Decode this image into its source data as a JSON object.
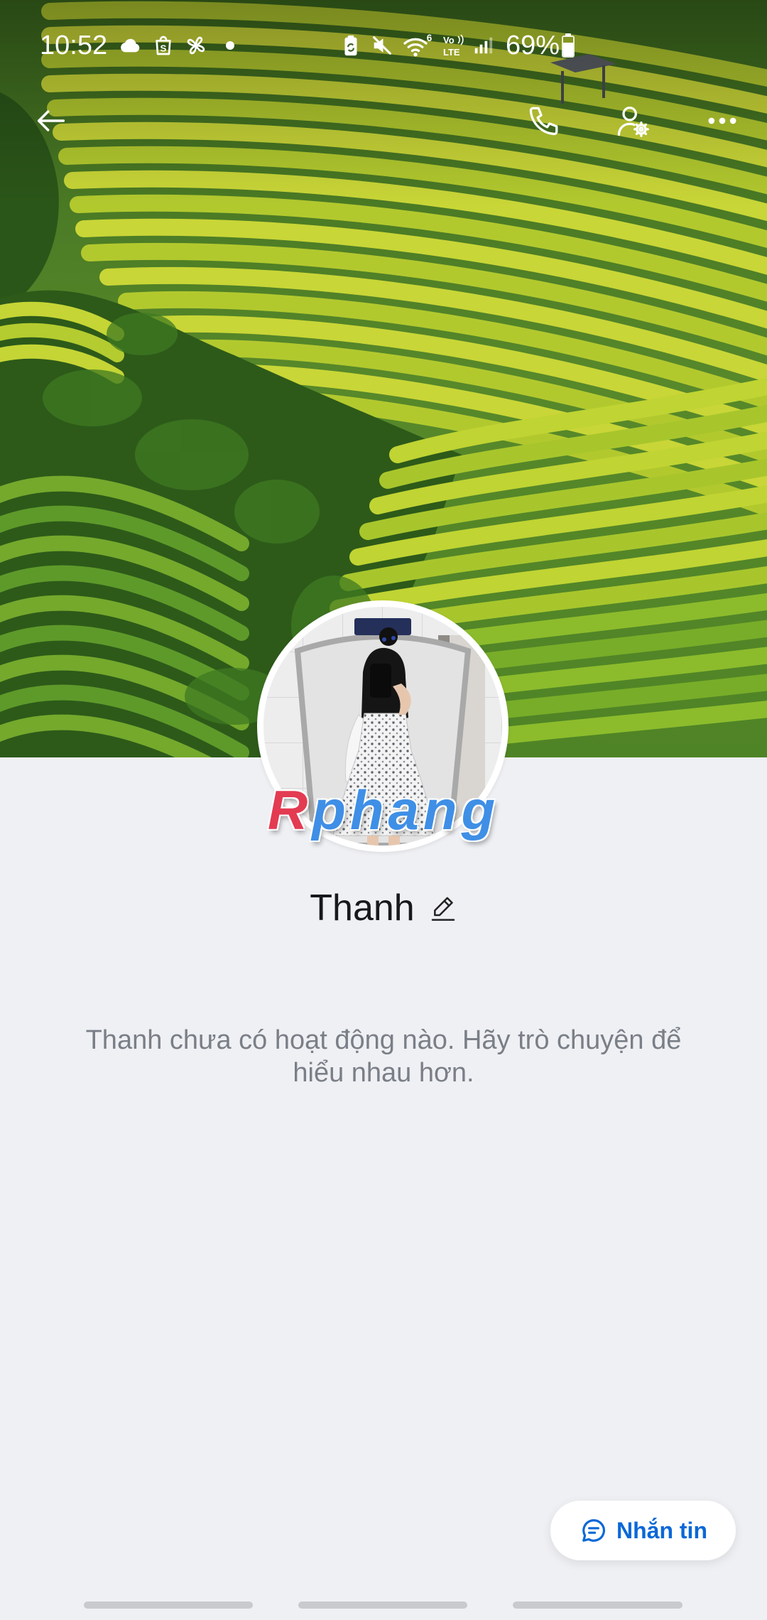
{
  "status_bar": {
    "time": "10:52",
    "shop_letter": "S",
    "wifi_badge": "6",
    "volte_top": "Vo",
    "volte_bottom": "LTE",
    "battery_percent": "69%",
    "left_icons": [
      "cloud-icon",
      "shopping-bag-icon",
      "pinwheel-icon",
      "notification-dot-icon"
    ],
    "right_icons": [
      "battery-saver-icon",
      "mute-icon",
      "wifi-icon",
      "volte-icon",
      "signal-icon",
      "battery-icon"
    ]
  },
  "app_bar": {
    "icons": [
      "back-arrow-icon",
      "phone-icon",
      "user-settings-icon",
      "more-icon"
    ]
  },
  "profile": {
    "name": "Thanh",
    "avatar_watermark": "Rphang",
    "edit_icon": "pencil-icon"
  },
  "empty_state": {
    "message": "Thanh chưa có hoạt động nào. Hãy trò chuyện để hiểu nhau hơn."
  },
  "action_button": {
    "label": "Nhắn tin",
    "icon": "chat-bubble-icon"
  },
  "colors": {
    "accent": "#0b68d7",
    "page_background": "#eff0f4",
    "name_text": "#16181b",
    "message_text": "#7a7f87",
    "cover_terrace": "#c9d637",
    "cover_forest": "#2d5a19"
  }
}
